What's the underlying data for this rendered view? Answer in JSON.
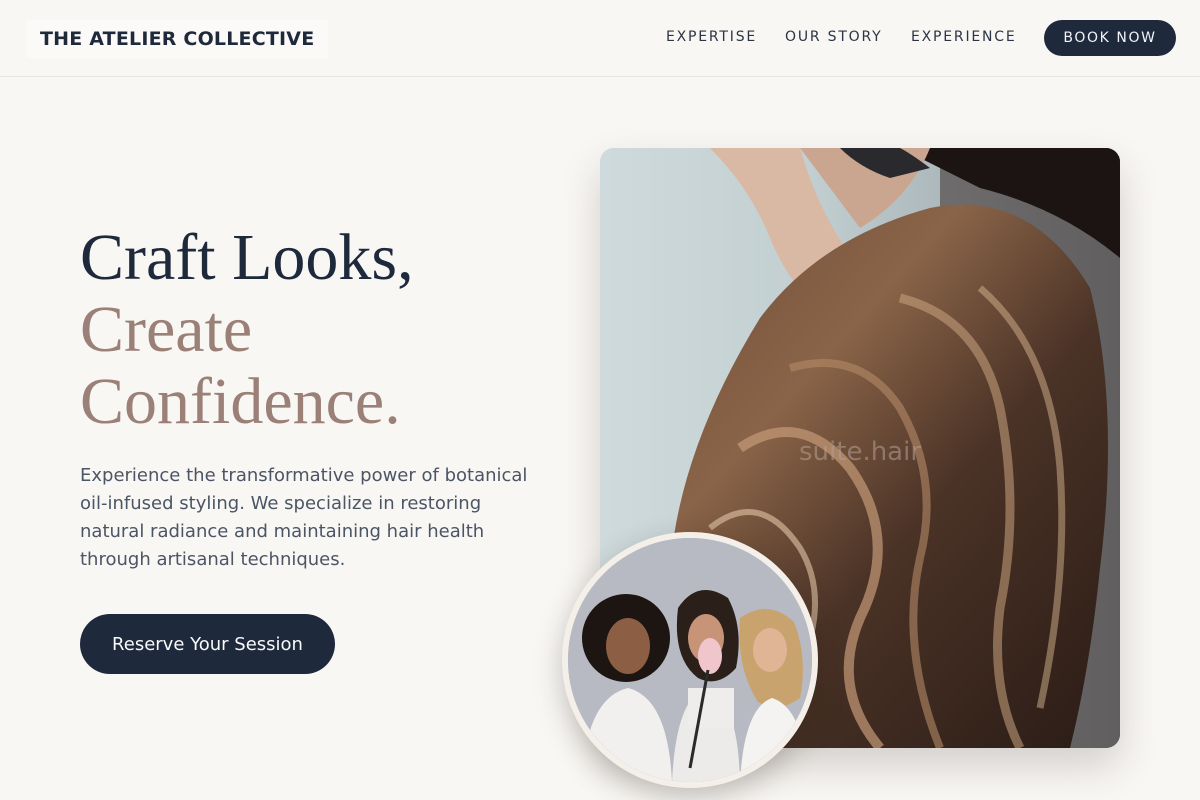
{
  "header": {
    "brand": "THE ATELIER COLLECTIVE",
    "nav": [
      {
        "label": "EXPERTISE"
      },
      {
        "label": "OUR STORY"
      },
      {
        "label": "EXPERIENCE"
      }
    ],
    "book_label": "BOOK NOW"
  },
  "hero": {
    "title_line1": "Craft Looks,",
    "title_line2": "Create",
    "title_line3": "Confidence.",
    "description": "Experience the transformative power of botanical oil-infused styling. We specialize in restoring natural radiance and maintaining hair health through artisanal techniques.",
    "cta_label": "Reserve Your Session"
  },
  "media": {
    "main_photo": "hair-styling-photo",
    "watermark": "suite.hair",
    "circle_photo": "three-women-portrait-photo"
  },
  "colors": {
    "navy": "#1e293b",
    "taupe": "#9b8078",
    "background": "#f9f7f4"
  }
}
